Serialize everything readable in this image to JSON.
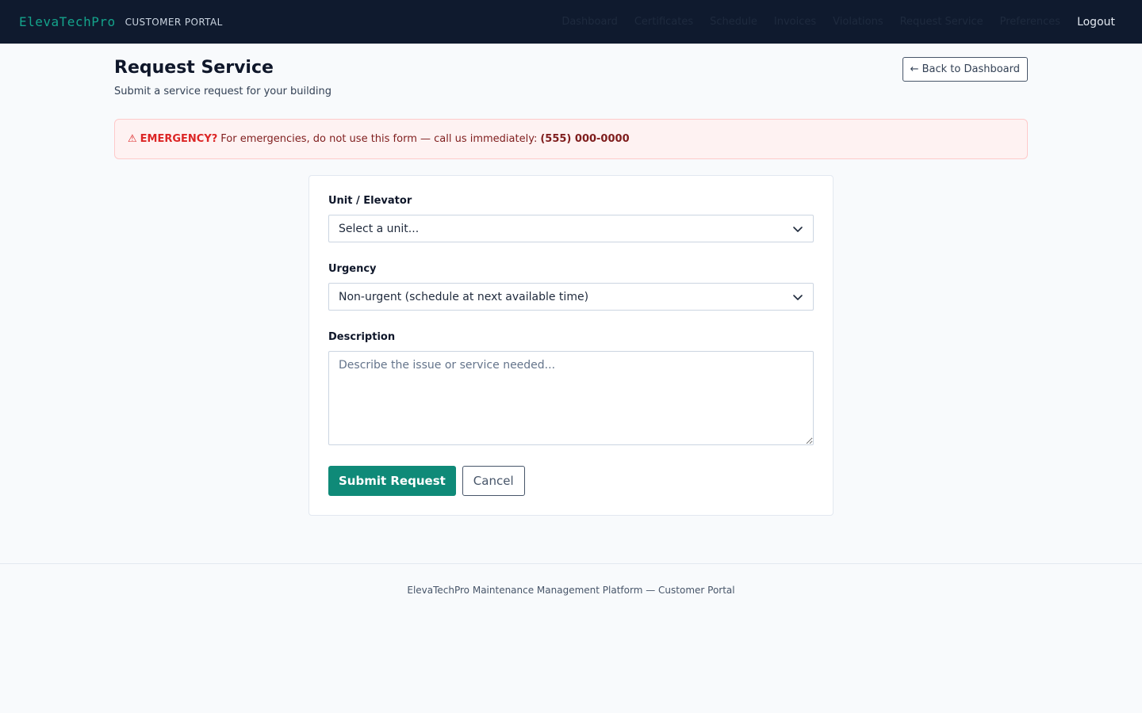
{
  "brand": "ElevaTechPro",
  "portal_label": "CUSTOMER PORTAL",
  "nav": {
    "items": [
      "Dashboard",
      "Certificates",
      "Schedule",
      "Invoices",
      "Violations",
      "Request Service",
      "Preferences"
    ],
    "logout": "Logout"
  },
  "page": {
    "title": "Request Service",
    "subtitle": "Submit a service request for your building",
    "back_button": "← Back to Dashboard"
  },
  "alert": {
    "icon": "⚠",
    "label": "EMERGENCY?",
    "message": "For emergencies, do not use this form — call us immediately:",
    "phone": "(555) 000-0000"
  },
  "form": {
    "unit_label": "Unit / Elevator",
    "unit_value": "Select a unit...",
    "urgency_label": "Urgency",
    "urgency_value": "Non-urgent (schedule at next available time)",
    "description_label": "Description",
    "description_placeholder": "Describe the issue or service needed...",
    "submit_label": "Submit Request",
    "cancel_label": "Cancel"
  },
  "footer": {
    "text": "ElevaTechPro Maintenance Management Platform — Customer Portal"
  }
}
